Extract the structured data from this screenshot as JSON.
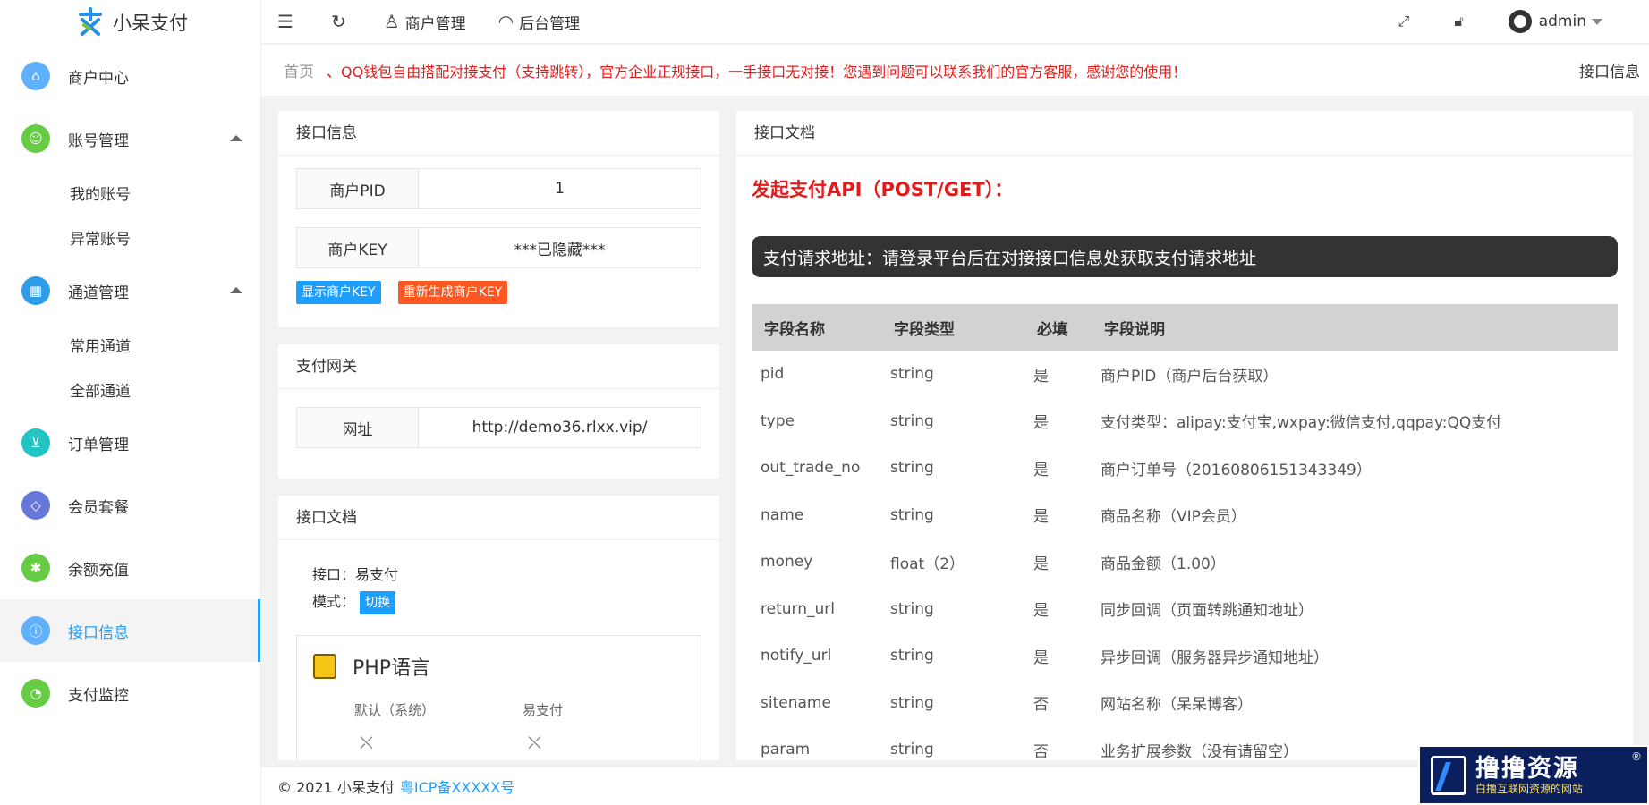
{
  "app": {
    "name": "小呆支付"
  },
  "sidebar": {
    "items": [
      {
        "label": "商户中心",
        "color": "#5fb1ff"
      },
      {
        "label": "账号管理",
        "color": "#66cc44",
        "children": [
          "我的账号",
          "异常账号"
        ]
      },
      {
        "label": "通道管理",
        "color": "#2f9ce8",
        "children": [
          "常用通道",
          "全部通道"
        ]
      },
      {
        "label": "订单管理",
        "color": "#22c4c4"
      },
      {
        "label": "会员套餐",
        "color": "#6577d8"
      },
      {
        "label": "余额充值",
        "color": "#66cc44"
      },
      {
        "label": "接口信息",
        "color": "#5fb1ff",
        "active": true
      },
      {
        "label": "支付监控",
        "color": "#66cc44"
      }
    ]
  },
  "topbar": {
    "merchant_mgmt": "商户管理",
    "backend_mgmt": "后台管理",
    "user": "admin"
  },
  "breadcrumb": {
    "home": "首页",
    "notice": "、QQ钱包自由搭配对接支付（支持跳转），官方企业正规接口，一手接口无对接！您遇到问题可以联系我们的官方客服，感谢您的使用！",
    "current": "接口信息"
  },
  "interface_info": {
    "title": "接口信息",
    "pid_label": "商户PID",
    "pid_value": "1",
    "key_label": "商户KEY",
    "key_value": "***已隐藏***",
    "show_key_btn": "显示商户KEY",
    "regen_key_btn": "重新生成商户KEY",
    "colors": {
      "show": "#1e9fff",
      "regen": "#ff5722"
    }
  },
  "gateway": {
    "title": "支付网关",
    "url_label": "网址",
    "url_value": "http://demo36.rlxx.vip/"
  },
  "left_doc": {
    "title": "接口文档",
    "iface_label": "接口：易支付",
    "mode_label": "模式：",
    "switch_btn": "切换",
    "php_title": "PHP语言",
    "opt_default": "默认（系统）",
    "opt_epay": "易支付"
  },
  "api_doc": {
    "title": "接口文档",
    "api_title": "发起支付API（POST/GET）：",
    "url_bar": "支付请求地址：请登录平台后在对接接口信息处获取支付请求地址",
    "headers": [
      "字段名称",
      "字段类型",
      "必填",
      "字段说明"
    ],
    "rows": [
      [
        "pid",
        "string",
        "是",
        "商户PID（商户后台获取）"
      ],
      [
        "type",
        "string",
        "是",
        "支付类型：alipay:支付宝,wxpay:微信支付,qqpay:QQ支付"
      ],
      [
        "out_trade_no",
        "string",
        "是",
        "商户订单号（20160806151343349）"
      ],
      [
        "name",
        "string",
        "是",
        "商品名称（VIP会员）"
      ],
      [
        "money",
        "float（2）",
        "是",
        "商品金额（1.00）"
      ],
      [
        "return_url",
        "string",
        "是",
        "同步回调（页面转跳通知地址）"
      ],
      [
        "notify_url",
        "string",
        "是",
        "异步回调（服务器异步通知地址）"
      ],
      [
        "sitename",
        "string",
        "否",
        "网站名称（呆呆博客）"
      ],
      [
        "param",
        "string",
        "否",
        "业务扩展参数（没有请留空）"
      ]
    ]
  },
  "footer": {
    "copyright": "© 2021 小呆支付",
    "icp": "粤ICP备XXXXX号"
  },
  "watermark": {
    "main": "撸撸资源",
    "sub": "白撸互联网资源的网站",
    "reg": "®"
  }
}
